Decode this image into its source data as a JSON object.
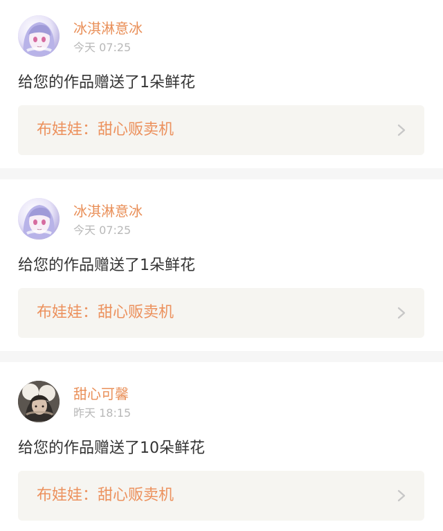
{
  "feed": {
    "items": [
      {
        "user": "冰淇淋意冰",
        "time": "今天 07:25",
        "message": "给您的作品赠送了1朵鲜花",
        "work": "布娃娃：甜心贩卖机",
        "avatar": "anime-avatar"
      },
      {
        "user": "冰淇淋意冰",
        "time": "今天 07:25",
        "message": "给您的作品赠送了1朵鲜花",
        "work": "布娃娃：甜心贩卖机",
        "avatar": "anime-avatar"
      },
      {
        "user": "甜心可馨",
        "time": "昨天 18:15",
        "message": "给您的作品赠送了10朵鲜花",
        "work": "布娃娃：甜心贩卖机",
        "avatar": "photo-avatar"
      }
    ]
  },
  "colors": {
    "username": "#e98f58",
    "work_link_text": "#ec915d",
    "work_link_background": "#f6f5f1",
    "divider": "#f6f6f6"
  },
  "icons": {
    "work_link": "chevron-right-icon"
  }
}
